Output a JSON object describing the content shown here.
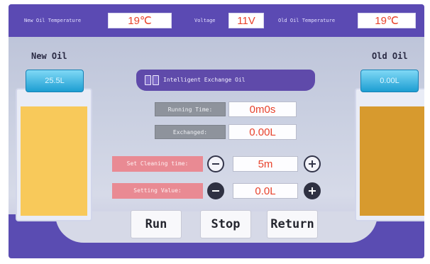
{
  "topbar": {
    "new_oil_temp_label": "New Oil Temperature",
    "new_oil_temp_value": "19℃",
    "voltage_label": "Voltage",
    "voltage_value": "11V",
    "old_oil_temp_label": "Old Oil Temperature",
    "old_oil_temp_value": "19℃"
  },
  "new_oil": {
    "title": "New Oil",
    "level": "25.5L",
    "fill_color": "#f8c95a"
  },
  "old_oil": {
    "title": "Old Oil",
    "level": "0.00L",
    "fill_color": "#d79a2e"
  },
  "center": {
    "title": "Intelligent Exchange Oil",
    "running_time_label": "Running Time:",
    "running_time_value": "0m0s",
    "exchanged_label": "Exchanged:",
    "exchanged_value": "0.00L",
    "cleaning_time_label": "Set Cleaning time:",
    "cleaning_time_value": "5m",
    "setting_value_label": "Setting Value:",
    "setting_value_value": "0.0L"
  },
  "buttons": {
    "run": "Run",
    "stop": "Stop",
    "return": "Return"
  },
  "colors": {
    "header": "#5b4ab3",
    "value_text": "#e8432c",
    "pink_label": "#e98a93",
    "gray_label": "#8e939c"
  }
}
